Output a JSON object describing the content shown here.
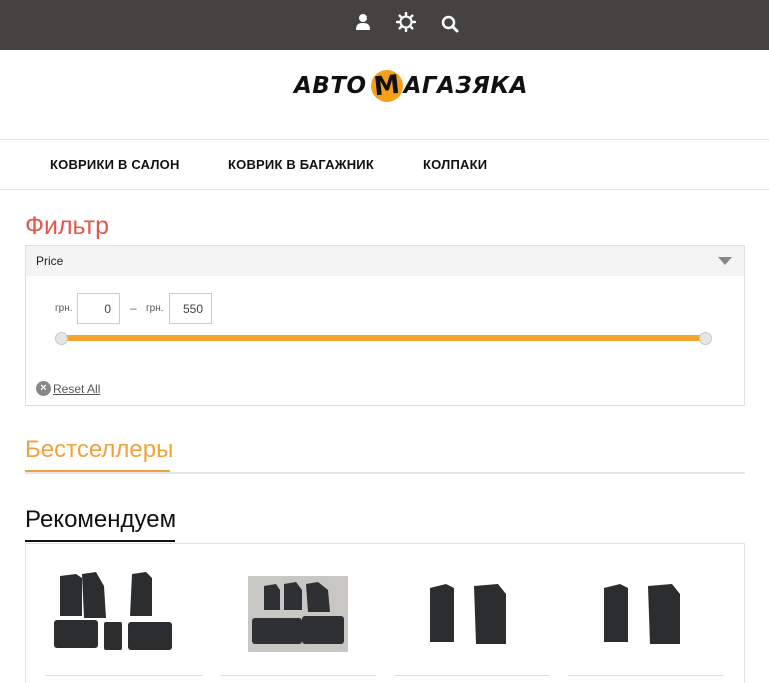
{
  "header": {
    "icons": [
      "user-icon",
      "gear-icon",
      "search-icon"
    ],
    "background": "#444342"
  },
  "logo": {
    "part1": "АВТО",
    "badge": "М",
    "part2": "АГАЗЯКА",
    "accent": "#f5a01a"
  },
  "nav": {
    "items": [
      {
        "label": "КОВРИКИ В САЛОН"
      },
      {
        "label": "КОВРИК В БАГАЖНИК"
      },
      {
        "label": "КОЛПАКИ"
      }
    ]
  },
  "filter": {
    "title": "Фильтр",
    "section_label": "Price",
    "currency": "грн.",
    "separator": "–",
    "min_value": "0",
    "max_value": "550",
    "reset_label": "Reset All",
    "slider_color": "#f3a42a",
    "title_color": "#e2584a"
  },
  "bestsellers": {
    "title": "Бестселлеры",
    "color": "#f0a23c"
  },
  "recommended": {
    "title": "Рекомендуем",
    "products": [
      {
        "image": "car-mats-set-image"
      },
      {
        "image": "car-mats-set-gray-background-image"
      },
      {
        "image": "car-mats-front-pair-image"
      },
      {
        "image": "car-mats-front-pair-image"
      }
    ]
  }
}
